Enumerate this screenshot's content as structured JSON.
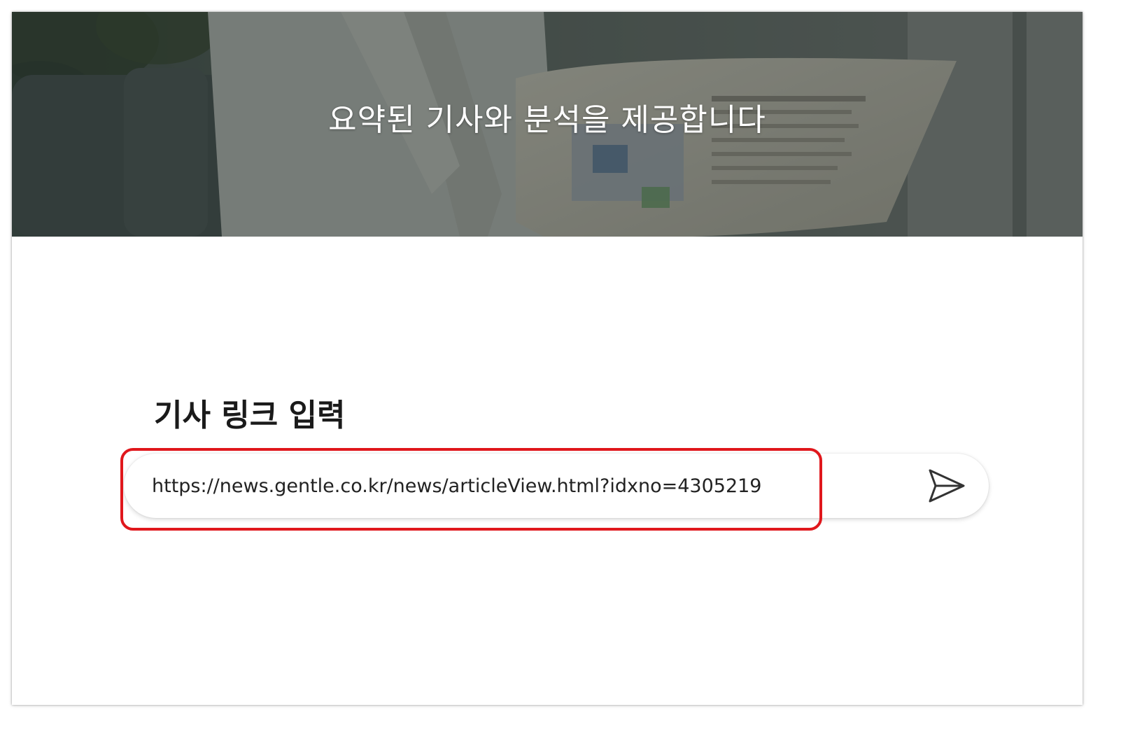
{
  "hero": {
    "title": "요약된 기사와 분석을 제공합니다"
  },
  "input_section": {
    "title": "기사 링크 입력",
    "url_value": "https://news.gentle.co.kr/news/articleView.html?idxno=4305219",
    "send_icon": "send-icon"
  },
  "colors": {
    "highlight": "#e0171c",
    "hero_overlay": "#4b5450"
  }
}
